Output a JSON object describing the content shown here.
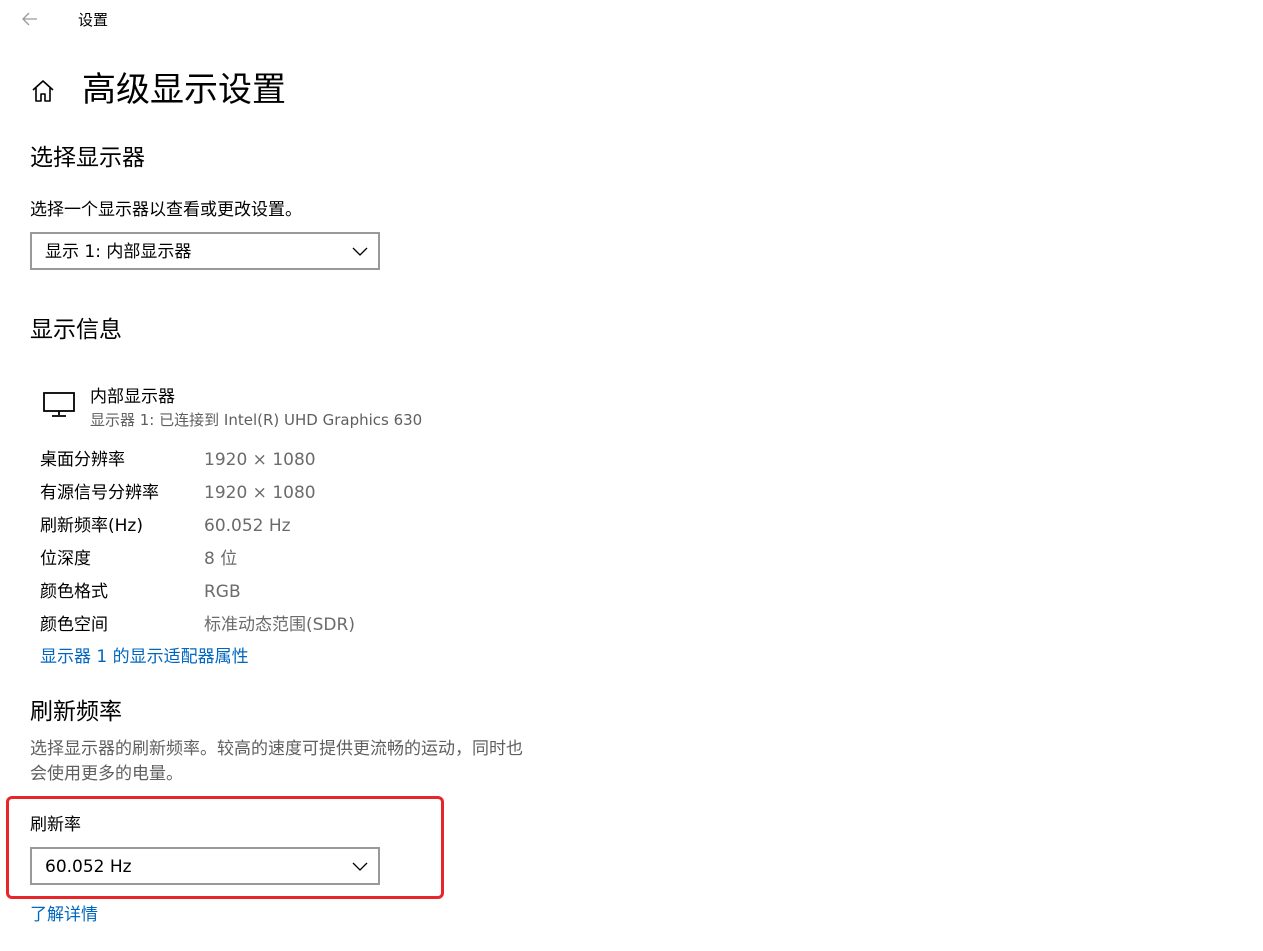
{
  "window": {
    "title": "设置"
  },
  "header": {
    "page_title": "高级显示设置"
  },
  "select_display": {
    "section_title": "选择显示器",
    "description": "选择一个显示器以查看或更改设置。",
    "selected_display": "显示 1: 内部显示器"
  },
  "display_info": {
    "section_title": "显示信息",
    "monitor_name": "内部显示器",
    "monitor_subtitle": "显示器 1: 已连接到 Intel(R) UHD Graphics 630",
    "rows": [
      {
        "label": "桌面分辨率",
        "value": "1920 × 1080"
      },
      {
        "label": "有源信号分辨率",
        "value": "1920 × 1080"
      },
      {
        "label": "刷新频率(Hz)",
        "value": "60.052 Hz"
      },
      {
        "label": "位深度",
        "value": "8 位"
      },
      {
        "label": "颜色格式",
        "value": "RGB"
      },
      {
        "label": "颜色空间",
        "value": "标准动态范围(SDR)"
      }
    ],
    "adapter_link": "显示器 1 的显示适配器属性"
  },
  "refresh_rate": {
    "section_title": "刷新频率",
    "description_line1": "选择显示器的刷新频率。较高的速度可提供更流畅的运动，同时也",
    "description_line2": "会使用更多的电量。",
    "field_label": "刷新率",
    "selected_value": "60.052 Hz",
    "learn_more_link": "了解详情"
  },
  "colors": {
    "link": "#0067c0",
    "highlight_border": "#e8262a",
    "secondary_text": "#5f5f5f"
  },
  "icons": {
    "back": "back-arrow-icon",
    "home": "home-icon",
    "monitor": "monitor-icon",
    "dropdown": "chevron-down-icon"
  }
}
